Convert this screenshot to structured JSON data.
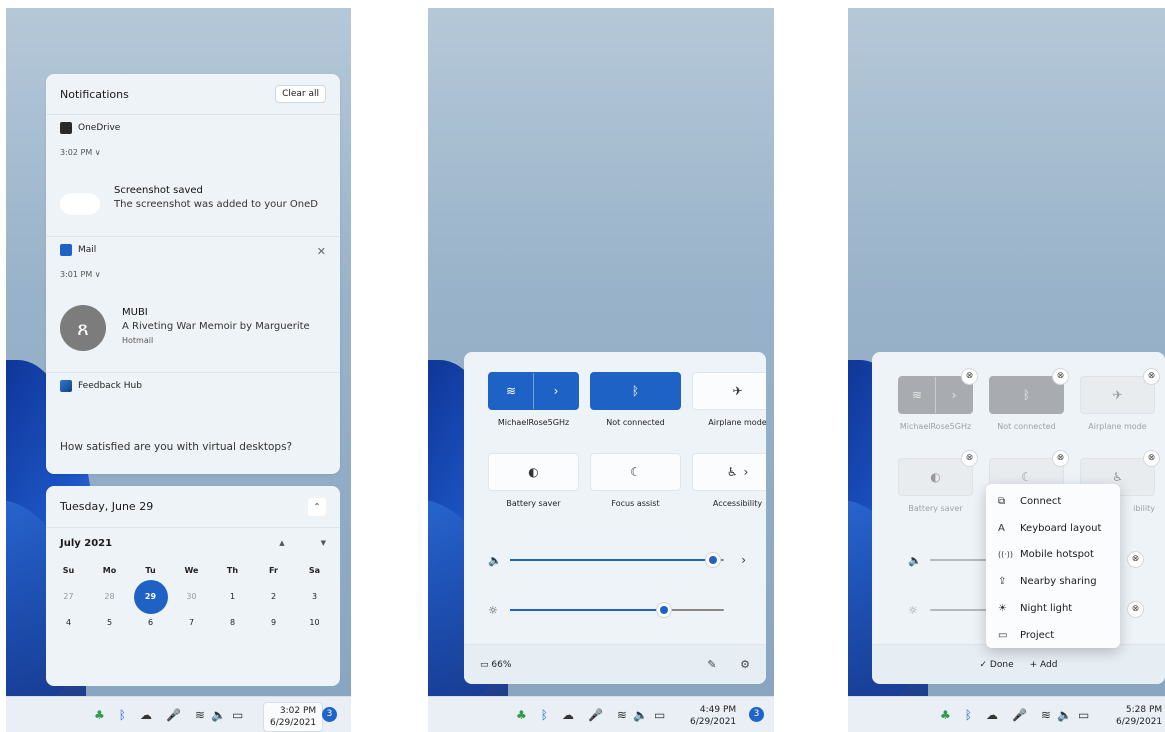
{
  "notifications": {
    "title": "Notifications",
    "clear_all": "Clear all",
    "groups": [
      {
        "app": "OneDrive",
        "time": "3:02 PM ∨",
        "title": "Screenshot saved",
        "body": "The screenshot was added to your OneD"
      },
      {
        "app": "Mail",
        "time": "3:01 PM ∨",
        "title": "MUBI",
        "body": "A Riveting War Memoir by Marguerite",
        "sub": "Hotmail",
        "avatar": "ጸ"
      },
      {
        "app": "Feedback Hub",
        "body": "How satisfied are you with virtual desktops?"
      }
    ],
    "close_glyph": "✕"
  },
  "calendar": {
    "date_header": "Tuesday, June 29",
    "collapse_glyph": "⌃",
    "month": "July 2021",
    "up_glyph": "▲",
    "down_glyph": "▼",
    "weekdays": [
      "Su",
      "Mo",
      "Tu",
      "We",
      "Th",
      "Fr",
      "Sa"
    ],
    "week1": [
      "27",
      "28",
      "29",
      "30",
      "1",
      "2",
      "3"
    ],
    "week2": [
      "4",
      "5",
      "6",
      "7",
      "8",
      "9",
      "10"
    ]
  },
  "quick_settings": {
    "tiles": [
      {
        "label": "MichaelRose5GHz",
        "icon": "≋",
        "chevron": "›"
      },
      {
        "label": "Not connected",
        "icon": "ᛒ"
      },
      {
        "label": "Airplane mode",
        "icon": "✈"
      },
      {
        "label": "Battery saver",
        "icon": "◐"
      },
      {
        "label": "Focus assist",
        "icon": "☾"
      },
      {
        "label": "Accessibility",
        "icon": "♿",
        "chevron": "›"
      }
    ],
    "volume_icon": "🔈",
    "volume_level": 0.95,
    "volume_chevron": "›",
    "brightness_icon": "☼",
    "brightness_level": 0.72,
    "battery": "▭ 66%",
    "edit_icon": "✎",
    "settings_icon": "⚙"
  },
  "edit_mode": {
    "unpin_glyph": "⊗",
    "done": "✓ Done",
    "add": "+ Add",
    "menu": [
      {
        "glyph": "⧉",
        "label": "Connect"
      },
      {
        "glyph": "A",
        "label": "Keyboard layout"
      },
      {
        "glyph": "((·))",
        "label": "Mobile hotspot"
      },
      {
        "glyph": "⇪",
        "label": "Nearby sharing"
      },
      {
        "glyph": "☀",
        "label": "Night light"
      },
      {
        "glyph": "▭",
        "label": "Project"
      }
    ],
    "tile_labels": [
      "MichaelRose5GHz",
      "Not connected",
      "Airplane mode",
      "Battery saver",
      "",
      "ibility"
    ]
  },
  "taskbar": {
    "icons": [
      "♣",
      "ᛒ",
      "☁",
      "🎤",
      "≋",
      "🔈",
      "▭"
    ],
    "panels": [
      {
        "time": "3:02 PM",
        "date": "6/29/2021",
        "badge": "3"
      },
      {
        "time": "4:49 PM",
        "date": "6/29/2021",
        "badge": "3"
      },
      {
        "time": "5:28 PM",
        "date": "6/29/2021"
      }
    ]
  },
  "colors": {
    "accent": "#1e62c6",
    "panel_bg": "#eef3f7"
  }
}
